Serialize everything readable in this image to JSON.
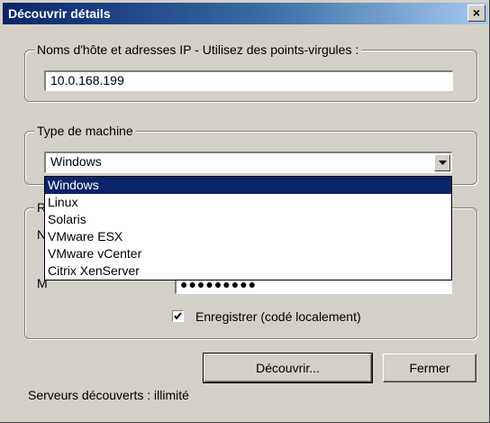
{
  "window": {
    "title": "Découvrir détails",
    "close_label": "×"
  },
  "hosts_group": {
    "legend": "Noms d'hôte et adresses IP - Utilisez des points-virgules :",
    "value": "10.0.168.199"
  },
  "machine_group": {
    "legend": "Type de machine",
    "selected": "Windows",
    "options": [
      "Windows",
      "Linux",
      "Solaris",
      "VMware ESX",
      "VMware vCenter",
      "Citrix XenServer"
    ]
  },
  "credentials_group": {
    "legend_visible": "R",
    "label1_visible": "N",
    "label2_visible": "M",
    "password_value": "●●●●●●●●●"
  },
  "save_checkbox": {
    "checked": true,
    "label": "Enregistrer (codé localement)"
  },
  "buttons": {
    "discover": "Découvrir...",
    "close": "Fermer"
  },
  "status": {
    "text": "Serveurs découverts : illimité"
  },
  "colors": {
    "title_bar_start": "#0a246a",
    "title_bar_end": "#a6caf0",
    "selection": "#0a246a",
    "dialog_bg": "#d4d0c8"
  }
}
